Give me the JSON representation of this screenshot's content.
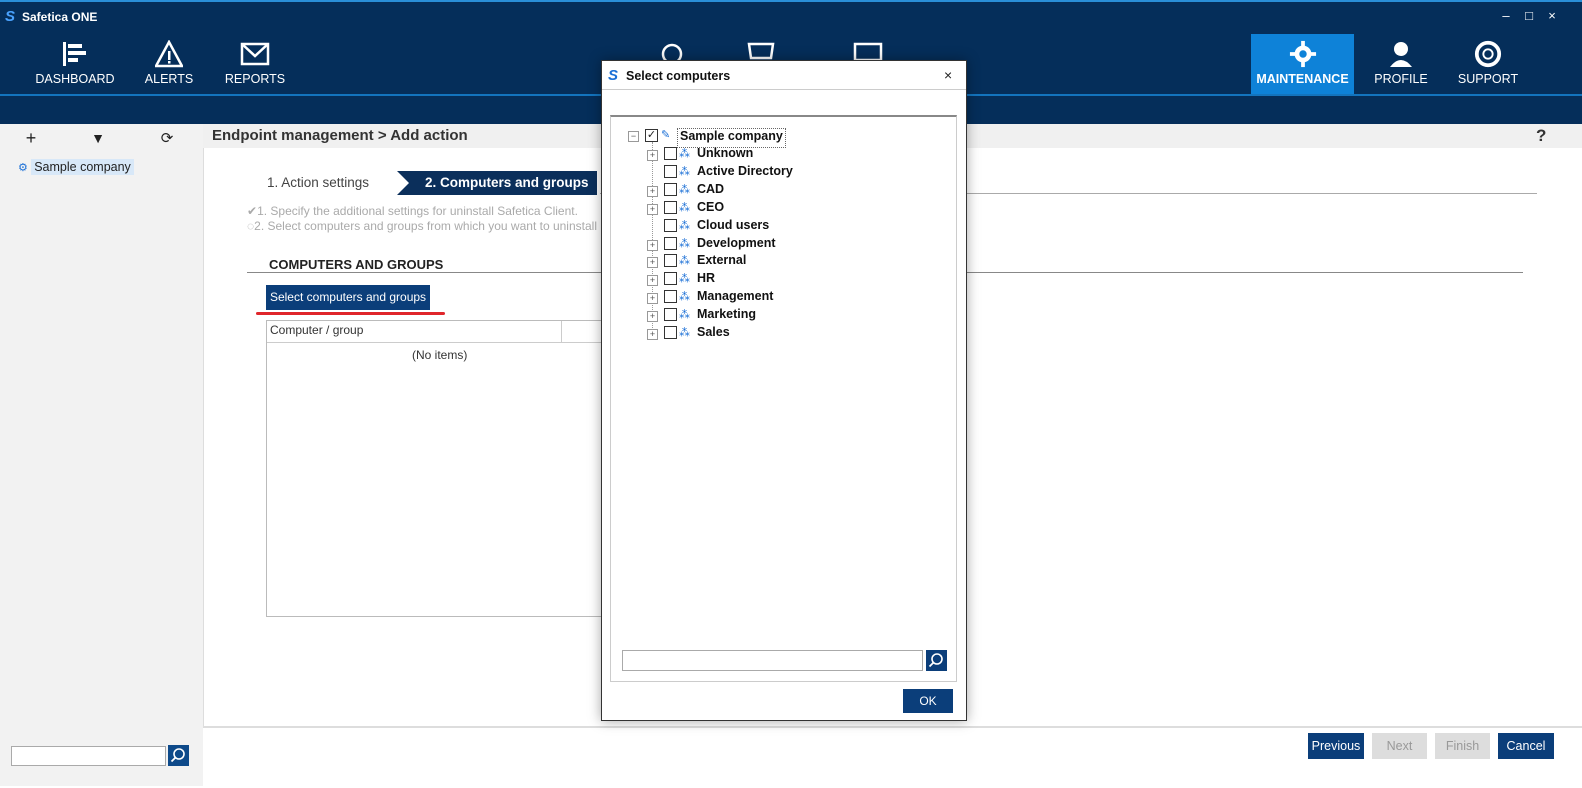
{
  "window": {
    "title": "Safetica ONE",
    "minimize": "–",
    "maximize": "□",
    "close": "×"
  },
  "nav": {
    "items": [
      {
        "label": "DASHBOARD"
      },
      {
        "label": "ALERTS"
      },
      {
        "label": "REPORTS"
      },
      {
        "label": "MAINTENANCE",
        "active": true
      },
      {
        "label": "PROFILE"
      },
      {
        "label": "SUPPORT"
      }
    ]
  },
  "left_panel": {
    "toolbar": {
      "add": "+",
      "filter": "▼",
      "refresh": "⟳"
    },
    "tree_root": "Sample company"
  },
  "header": {
    "breadcrumb": "Endpoint management > Add action",
    "help": "?"
  },
  "wizard": {
    "step1": "1. Action settings",
    "step2": "2. Computers and groups",
    "hint1": "1. Specify the additional settings for uninstall Safetica Client.",
    "hint2": "2. Select computers and groups from which you want to uninstall",
    "section_title": "COMPUTERS AND GROUPS",
    "select_button": "Select computers and groups",
    "grid_column": "Computer / group",
    "grid_empty": "(No items)"
  },
  "bottom": {
    "previous": "Previous",
    "next": "Next",
    "finish": "Finish",
    "cancel": "Cancel"
  },
  "dialog": {
    "title": "Select computers",
    "close": "×",
    "root": "Sample company",
    "groups": [
      {
        "label": "Unknown",
        "expandable": true
      },
      {
        "label": "Active Directory",
        "expandable": false
      },
      {
        "label": "CAD",
        "expandable": true
      },
      {
        "label": "CEO",
        "expandable": true
      },
      {
        "label": "Cloud users",
        "expandable": false
      },
      {
        "label": "Development",
        "expandable": true
      },
      {
        "label": "External",
        "expandable": true
      },
      {
        "label": "HR",
        "expandable": true
      },
      {
        "label": "Management",
        "expandable": true
      },
      {
        "label": "Marketing",
        "expandable": true
      },
      {
        "label": "Sales",
        "expandable": true
      }
    ],
    "search_placeholder": "",
    "ok": "OK"
  },
  "colors": {
    "nav_bg": "#052e5a",
    "accent": "#0e82d8",
    "button": "#0b3e7a",
    "highlight": "#e0262b"
  }
}
